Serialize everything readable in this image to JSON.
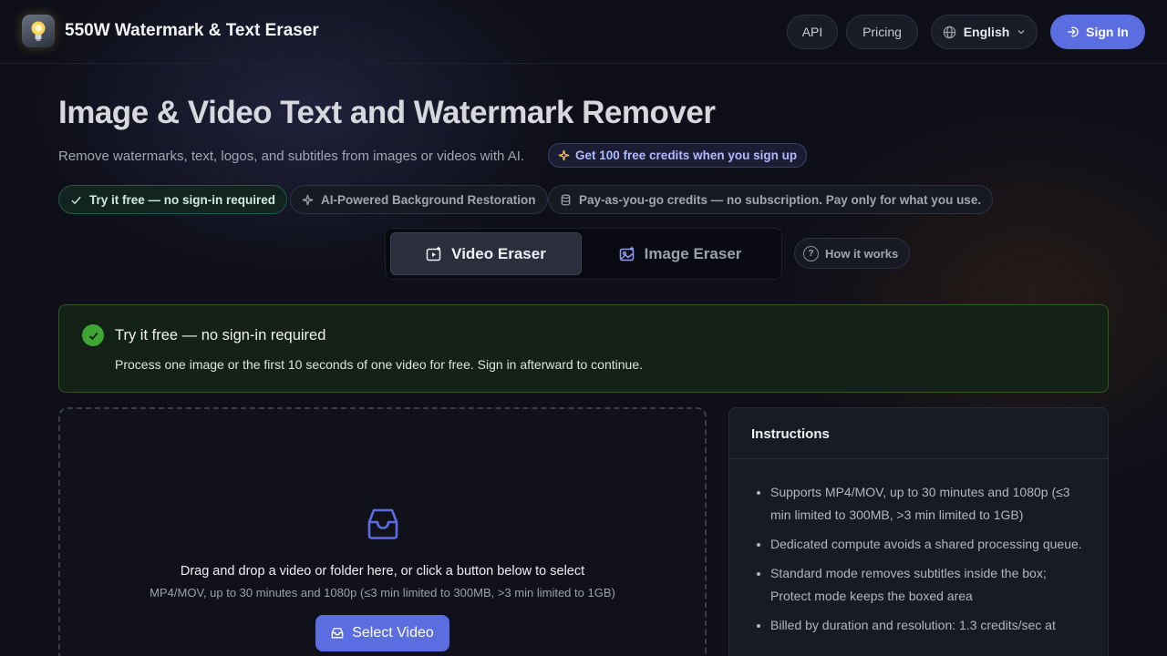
{
  "header": {
    "app_title": "550W Watermark & Text Eraser",
    "nav_api": "API",
    "nav_pricing": "Pricing",
    "language": "English",
    "sign_in": "Sign In"
  },
  "hero": {
    "title": "Image & Video Text and Watermark Remover",
    "subtitle": "Remove watermarks, text, logos, and subtitles from images or videos with AI.",
    "credits_badge": "Get 100 free credits when you sign up"
  },
  "features": [
    "Try it free — no sign-in required",
    "AI-Powered Background Restoration",
    "Pay-as-you-go credits — no subscription. Pay only for what you use."
  ],
  "tabs": {
    "video": "Video Eraser",
    "image": "Image Eraser",
    "active": "video",
    "how_it_works": "How it works"
  },
  "notice": {
    "title": "Try it free — no sign-in required",
    "description": "Process one image or the first 10 seconds of one video for free. Sign in afterward to continue."
  },
  "dropzone": {
    "main_text": "Drag and drop a video or folder here, or click a button below to select",
    "sub_text": "MP4/MOV, up to 30 minutes and 1080p (≤3 min limited to 300MB, >3 min limited to 1GB)",
    "button": "Select Video"
  },
  "instructions": {
    "title": "Instructions",
    "items": [
      "Supports MP4/MOV, up to 30 minutes and 1080p (≤3 min limited to 300MB, >3 min limited to 1GB)",
      "Dedicated compute avoids a shared processing queue.",
      "Standard mode removes subtitles inside the box; Protect mode keeps the boxed area",
      "Billed by duration and resolution: 1.3 credits/sec at"
    ]
  },
  "colors": {
    "accent": "#5b6ee1",
    "success": "#3fa535",
    "background": "#0e0f18"
  },
  "icons": {
    "logo": "lightbulb-icon",
    "language": "globe-icon",
    "sign_in": "login-icon",
    "credits": "sparkle-icon",
    "check": "check-icon",
    "upload": "inbox-icon"
  }
}
